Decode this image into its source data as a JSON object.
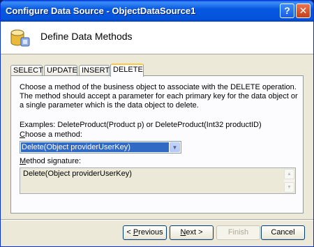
{
  "window": {
    "title": "Configure Data Source - ObjectDataSource1",
    "help_label": "?",
    "close_label": "✕"
  },
  "header": {
    "title": "Define Data Methods",
    "icon": "database-icon"
  },
  "tabs": [
    {
      "label": "SELECT",
      "active": false
    },
    {
      "label": "UPDATE",
      "active": false
    },
    {
      "label": "INSERT",
      "active": false
    },
    {
      "label": "DELETE",
      "active": true
    }
  ],
  "panel": {
    "description": "Choose a method of the business object to associate with the DELETE operation. The method should accept a parameter for each primary key for the data object or a single parameter which is the data object to delete.",
    "examples": "Examples: DeleteProduct(Product p) or DeleteProduct(Int32 productID)",
    "method_label": "Choose a method:",
    "method_value": "Delete(Object providerUserKey)",
    "signature_label": "Method signature:",
    "signature_value": "Delete(Object providerUserKey)"
  },
  "footer": {
    "previous_label": "< Previous",
    "next_label": "Next >",
    "finish_label": "Finish",
    "cancel_label": "Cancel"
  },
  "colors": {
    "titlebar": "#0758e0",
    "selection": "#316ac5",
    "active_tab_accent": "#ffc73c"
  }
}
